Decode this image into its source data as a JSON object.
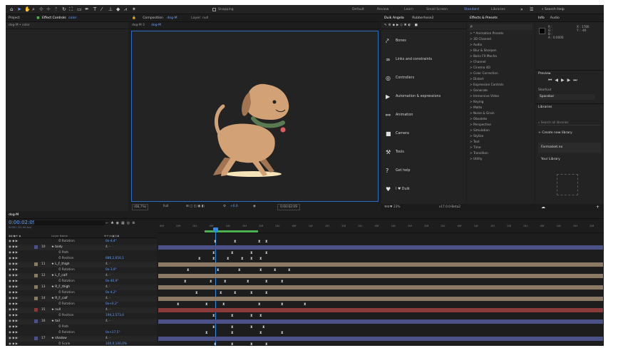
{
  "app": {
    "colors": {
      "bg": "#1d1d1d",
      "panel": "#232323",
      "accent": "#6ba4ff",
      "blue": "#2d8ceb"
    }
  },
  "toolbar": {
    "snapping": "Snapping",
    "workspaces": [
      "Default",
      "Review",
      "Learn",
      "Small Screen",
      "Standard",
      "Libraries"
    ],
    "search": "Search Help"
  },
  "left": {
    "tab_project": "Project",
    "tab_effects": "Effect Controls",
    "effects_target": "color",
    "subtitle": "dog-M • color"
  },
  "comp": {
    "tab_label": "Composition",
    "comp_name": "dog-M",
    "layer_tab": "Layer: null",
    "crumb1": "dog-M 3",
    "crumb2": "dog-M",
    "zoom": "(66,7%)",
    "quality": "Full",
    "exposure": "+0,0",
    "timecode": "0:00:02:09"
  },
  "duik": {
    "tab1": "Duik Angela",
    "tab2": "Rubberhose2",
    "items": [
      {
        "icon": "bones-icon",
        "label": "Bones"
      },
      {
        "icon": "link-icon",
        "label": "Links and constraints"
      },
      {
        "icon": "controller-icon",
        "label": "Controllers"
      },
      {
        "icon": "play-icon",
        "label": "Automation & expressions"
      },
      {
        "icon": "walk-icon",
        "label": "Animation"
      },
      {
        "icon": "camera-icon",
        "label": "Camera"
      },
      {
        "icon": "tools-icon",
        "label": "Tools"
      },
      {
        "icon": "help-icon",
        "label": "Get help"
      },
      {
        "icon": "heart-icon",
        "label": "I ♥ Duik"
      }
    ],
    "footer": "23%",
    "footer_ver": "v17.0.0-Beta2"
  },
  "effects": {
    "tab": "Effects & Presets",
    "search": "ρ",
    "items": [
      "> * Animation Presets",
      "> 3D Channel",
      "> Audio",
      "> Blur & Sharpen",
      "> Boris FX Mocha",
      "> Channel",
      "> Cinema 4D",
      "> Color Correction",
      "> Distort",
      "> Expression Controls",
      "> Generate",
      "> Immersive Video",
      "> Keying",
      "> Matte",
      "> Noise & Grain",
      "> Obsolete",
      "> Perspective",
      "> Simulation",
      "> Stylize",
      "> Text",
      "> Time",
      "> Transition",
      "> Utility"
    ]
  },
  "info": {
    "tab1": "Info",
    "tab2": "Audio",
    "r": "R :",
    "g": "G :",
    "b": "B :",
    "a": "A : 0.0000",
    "x": "X : 1780",
    "y": "Y : -40",
    "preview": "Preview",
    "shortcut": "Shortcut",
    "shortcut_val": "Spacebar",
    "libraries": "Libraries",
    "lib_search": "Search all libraries",
    "create": "Create new library",
    "lib1": "Farmasket.no",
    "lib2": "Your Library"
  },
  "timeline": {
    "tab": "dog-M",
    "time": "0:00:02:09",
    "time_sub": "00061 (25,00 fps)",
    "col_layer": "Layer Name",
    "col_parent": "Parent & Link",
    "ticks": [
      "00f",
      "05f",
      "01f",
      "05f",
      "10f",
      "15f",
      "20f",
      "01f",
      "05f",
      "10f",
      "15f",
      "20f",
      "01f",
      "05f",
      "10f",
      "15f",
      "20f",
      "01f",
      "05f",
      "10f",
      "15f",
      "20f",
      "01f",
      "05f",
      "10f",
      "15f",
      "20f"
    ],
    "rows": [
      {
        "num": "",
        "name": "Rotation",
        "val": "0x-4,4°",
        "layer": false,
        "color": ""
      },
      {
        "num": "10",
        "name": "body",
        "val": "4. -",
        "layer": true,
        "color": "#4c5288"
      },
      {
        "num": "",
        "name": "Path",
        "val": "",
        "layer": false,
        "color": ""
      },
      {
        "num": "",
        "name": "Position",
        "val": "686,2,650,1",
        "layer": false,
        "color": ""
      },
      {
        "num": "11",
        "name": "L_F_thigh",
        "val": "4. -",
        "layer": true,
        "color": "#8a7a66"
      },
      {
        "num": "",
        "name": "Rotation",
        "val": "0x-3,9°",
        "layer": false,
        "color": ""
      },
      {
        "num": "12",
        "name": "L_F_calf",
        "val": "4. -",
        "layer": true,
        "color": "#8a7a66"
      },
      {
        "num": "",
        "name": "Rotation",
        "val": "0x-40,9°",
        "layer": false,
        "color": ""
      },
      {
        "num": "13",
        "name": "R_F_thigh",
        "val": "4. -",
        "layer": true,
        "color": "#8a7a66"
      },
      {
        "num": "",
        "name": "Rotation",
        "val": "0x-4,2°",
        "layer": false,
        "color": ""
      },
      {
        "num": "14",
        "name": "R_F_calf",
        "val": "4. -",
        "layer": true,
        "color": "#8a7a66"
      },
      {
        "num": "",
        "name": "Rotation",
        "val": "0x+0,2°",
        "layer": false,
        "color": ""
      },
      {
        "num": "15",
        "name": "null",
        "val": "4. -",
        "layer": true,
        "color": "#8a3a3a"
      },
      {
        "num": "",
        "name": "Position",
        "val": "194,2,573,0",
        "layer": false,
        "color": ""
      },
      {
        "num": "16",
        "name": "tail",
        "val": "4. -",
        "layer": true,
        "color": "#4c5288"
      },
      {
        "num": "",
        "name": "Path",
        "val": "",
        "layer": false,
        "color": ""
      },
      {
        "num": "",
        "name": "Rotation",
        "val": "0x+27,5°",
        "layer": false,
        "color": ""
      },
      {
        "num": "17",
        "name": "shadow",
        "val": "4. -",
        "layer": true,
        "color": "#4c5288"
      },
      {
        "num": "",
        "name": "Scale",
        "val": "100,0,100,0%",
        "layer": false,
        "color": ""
      }
    ]
  }
}
